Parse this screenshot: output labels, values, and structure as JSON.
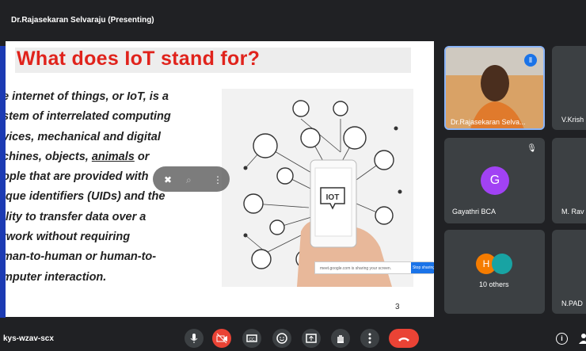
{
  "presenter": {
    "title": "Dr.Rajasekaran Selvaraju (Presenting)"
  },
  "slide": {
    "title": "What does IoT stand for?",
    "lines": [
      "e internet of things, or IoT, is a",
      "stem of interrelated computing",
      "vices, mechanical and digital",
      "chines, objects, ",
      "animals",
      " or",
      "ople that are provided with",
      "ique identifiers (UIDs) and the",
      "ility to transfer data over a",
      "twork without requiring",
      "man-to-human or human-to-",
      "mputer interaction."
    ],
    "illustration_label": "IOT",
    "url_text": "meet.google.com is sharing your screen.",
    "share_button": "Stop sharing",
    "page_marker": "3"
  },
  "participants": [
    {
      "name": "Dr.Rajasekaran Selva...",
      "type": "video"
    },
    {
      "name": "V.Krish",
      "type": "partial"
    },
    {
      "name": "Gayathri BCA",
      "initial": "G",
      "color": "#a142f4"
    },
    {
      "name": "M. Rav",
      "type": "partial"
    },
    {
      "name": "10 others",
      "initial": "H",
      "color": "#f57c00"
    },
    {
      "name": "N.PAD",
      "type": "partial"
    }
  ],
  "meeting_code": "kys-wzav-scx",
  "colors": {
    "background": "#202124",
    "tile": "#3c4043",
    "accent_blue": "#1a73e8",
    "end_red": "#ea4335",
    "slide_title_red": "#e0231c"
  },
  "icons": [
    "mic-icon",
    "camera-off-icon",
    "captions-icon",
    "emoji-icon",
    "present-icon",
    "raise-hand-icon",
    "more-options-icon",
    "end-call-icon",
    "info-icon",
    "people-icon"
  ]
}
